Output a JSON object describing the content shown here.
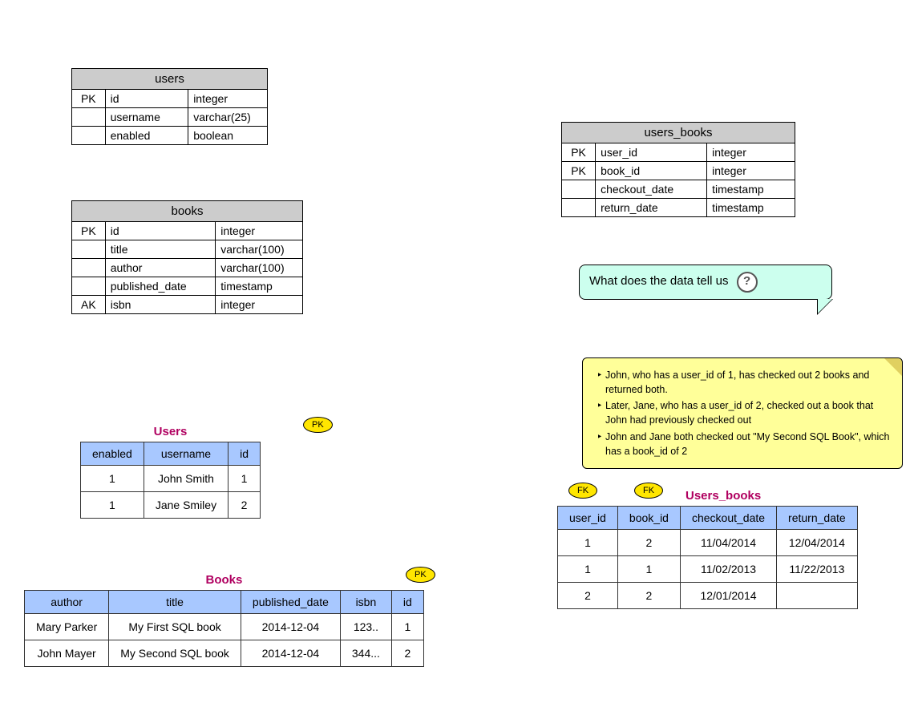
{
  "schema_users": {
    "title": "users",
    "rows": [
      {
        "key": "PK",
        "name": "id",
        "type": "integer"
      },
      {
        "key": "",
        "name": "username",
        "type": "varchar(25)"
      },
      {
        "key": "",
        "name": "enabled",
        "type": "boolean"
      }
    ]
  },
  "schema_books": {
    "title": "books",
    "rows": [
      {
        "key": "PK",
        "name": "id",
        "type": "integer"
      },
      {
        "key": "",
        "name": "title",
        "type": "varchar(100)"
      },
      {
        "key": "",
        "name": "author",
        "type": "varchar(100)"
      },
      {
        "key": "",
        "name": "published_date",
        "type": "timestamp"
      },
      {
        "key": "AK",
        "name": "isbn",
        "type": "integer"
      }
    ]
  },
  "schema_users_books": {
    "title": "users_books",
    "rows": [
      {
        "key": "PK",
        "name": "user_id",
        "type": "integer"
      },
      {
        "key": "PK",
        "name": "book_id",
        "type": "integer"
      },
      {
        "key": "",
        "name": "checkout_date",
        "type": "timestamp"
      },
      {
        "key": "",
        "name": "return_date",
        "type": "timestamp"
      }
    ]
  },
  "badges": {
    "pk": "PK",
    "fk": "FK"
  },
  "data_users": {
    "title": "Users",
    "cols": [
      "enabled",
      "username",
      "id"
    ],
    "rows": [
      [
        "1",
        "John Smith",
        "1"
      ],
      [
        "1",
        "Jane Smiley",
        "2"
      ]
    ]
  },
  "data_books": {
    "title": "Books",
    "cols": [
      "author",
      "title",
      "published_date",
      "isbn",
      "id"
    ],
    "rows": [
      [
        "Mary Parker",
        "My First SQL book",
        "2014-12-04",
        "123..",
        "1"
      ],
      [
        "John Mayer",
        "My Second SQL book",
        "2014-12-04",
        "344...",
        "2"
      ]
    ]
  },
  "data_users_books": {
    "title": "Users_books",
    "cols": [
      "user_id",
      "book_id",
      "checkout_date",
      "return_date"
    ],
    "rows": [
      [
        "1",
        "2",
        "11/04/2014",
        "12/04/2014"
      ],
      [
        "1",
        "1",
        "11/02/2013",
        "11/22/2013"
      ],
      [
        "2",
        "2",
        "12/01/2014",
        ""
      ]
    ]
  },
  "callout": {
    "text": "What does the data tell us",
    "icon": "?"
  },
  "note": {
    "items": [
      "John, who has a user_id of 1, has checked out 2 books and returned both.",
      "Later, Jane, who has a user_id of 2, checked out a book that John had previously checked out",
      "John and Jane both checked out \"My Second SQL Book\", which has a book_id of 2"
    ]
  },
  "chart_data": {
    "type": "table",
    "description": "Entity-relationship diagram with three schema tables (users, books, users_books) and three populated data tables, plus an explanatory note.",
    "schemas": {
      "users": [
        [
          "PK",
          "id",
          "integer"
        ],
        [
          "",
          "username",
          "varchar(25)"
        ],
        [
          "",
          "enabled",
          "boolean"
        ]
      ],
      "books": [
        [
          "PK",
          "id",
          "integer"
        ],
        [
          "",
          "title",
          "varchar(100)"
        ],
        [
          "",
          "author",
          "varchar(100)"
        ],
        [
          "",
          "published_date",
          "timestamp"
        ],
        [
          "AK",
          "isbn",
          "integer"
        ]
      ],
      "users_books": [
        [
          "PK",
          "user_id",
          "integer"
        ],
        [
          "PK",
          "book_id",
          "integer"
        ],
        [
          "",
          "checkout_date",
          "timestamp"
        ],
        [
          "",
          "return_date",
          "timestamp"
        ]
      ]
    },
    "data": {
      "Users": {
        "columns": [
          "enabled",
          "username",
          "id"
        ],
        "rows": [
          [
            "1",
            "John Smith",
            "1"
          ],
          [
            "1",
            "Jane Smiley",
            "2"
          ]
        ],
        "pk": "id"
      },
      "Books": {
        "columns": [
          "author",
          "title",
          "published_date",
          "isbn",
          "id"
        ],
        "rows": [
          [
            "Mary Parker",
            "My First SQL book",
            "2014-12-04",
            "123..",
            "1"
          ],
          [
            "John Mayer",
            "My Second SQL book",
            "2014-12-04",
            "344...",
            "2"
          ]
        ],
        "pk": "id"
      },
      "Users_books": {
        "columns": [
          "user_id",
          "book_id",
          "checkout_date",
          "return_date"
        ],
        "rows": [
          [
            "1",
            "2",
            "11/04/2014",
            "12/04/2014"
          ],
          [
            "1",
            "1",
            "11/02/2013",
            "11/22/2013"
          ],
          [
            "2",
            "2",
            "12/01/2014",
            ""
          ]
        ],
        "fk": [
          "user_id",
          "book_id"
        ]
      }
    }
  }
}
